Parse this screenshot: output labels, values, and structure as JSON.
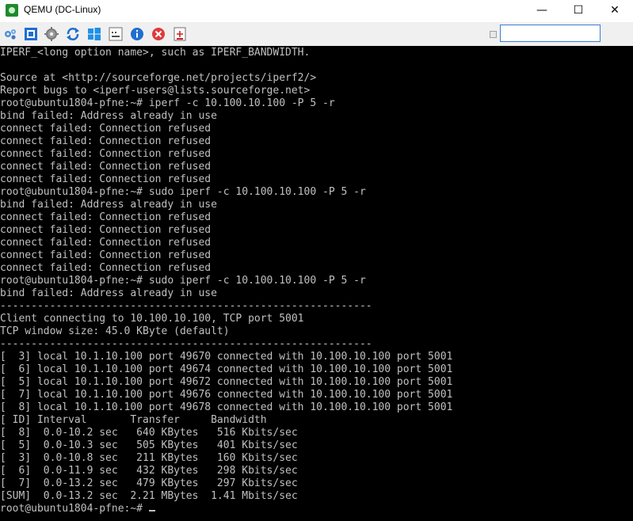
{
  "window": {
    "title": "QEMU (DC-Linux)",
    "minimize": "—",
    "maximize": "☐",
    "close": "✕"
  },
  "toolbar": {
    "icons": [
      "settings-cog-icon",
      "fullscreen-icon",
      "gear-icon",
      "refresh-icon",
      "windows-icon",
      "keyboard-icon",
      "info-icon",
      "stop-icon",
      "usb-icon"
    ],
    "search_value": ""
  },
  "terminal": {
    "lines": [
      "IPERF_<long option name>, such as IPERF_BANDWIDTH.",
      "",
      "Source at <http://sourceforge.net/projects/iperf2/>",
      "Report bugs to <iperf-users@lists.sourceforge.net>",
      "root@ubuntu1804-pfne:~# iperf -c 10.100.10.100 -P 5 -r",
      "bind failed: Address already in use",
      "connect failed: Connection refused",
      "connect failed: Connection refused",
      "connect failed: Connection refused",
      "connect failed: Connection refused",
      "connect failed: Connection refused",
      "root@ubuntu1804-pfne:~# sudo iperf -c 10.100.10.100 -P 5 -r",
      "bind failed: Address already in use",
      "connect failed: Connection refused",
      "connect failed: Connection refused",
      "connect failed: Connection refused",
      "connect failed: Connection refused",
      "connect failed: Connection refused",
      "root@ubuntu1804-pfne:~# sudo iperf -c 10.100.10.100 -P 5 -r",
      "bind failed: Address already in use",
      "------------------------------------------------------------",
      "Client connecting to 10.100.10.100, TCP port 5001",
      "TCP window size: 45.0 KByte (default)",
      "------------------------------------------------------------",
      "[  3] local 10.1.10.100 port 49670 connected with 10.100.10.100 port 5001",
      "[  6] local 10.1.10.100 port 49674 connected with 10.100.10.100 port 5001",
      "[  5] local 10.1.10.100 port 49672 connected with 10.100.10.100 port 5001",
      "[  7] local 10.1.10.100 port 49676 connected with 10.100.10.100 port 5001",
      "[  8] local 10.1.10.100 port 49678 connected with 10.100.10.100 port 5001",
      "[ ID] Interval       Transfer     Bandwidth",
      "[  8]  0.0-10.2 sec   640 KBytes   516 Kbits/sec",
      "[  5]  0.0-10.3 sec   505 KBytes   401 Kbits/sec",
      "[  3]  0.0-10.8 sec   211 KBytes   160 Kbits/sec",
      "[  6]  0.0-11.9 sec   432 KBytes   298 Kbits/sec",
      "[  7]  0.0-13.2 sec   479 KBytes   297 Kbits/sec",
      "[SUM]  0.0-13.2 sec  2.21 MBytes  1.41 Mbits/sec"
    ],
    "prompt": "root@ubuntu1804-pfne:~# "
  }
}
